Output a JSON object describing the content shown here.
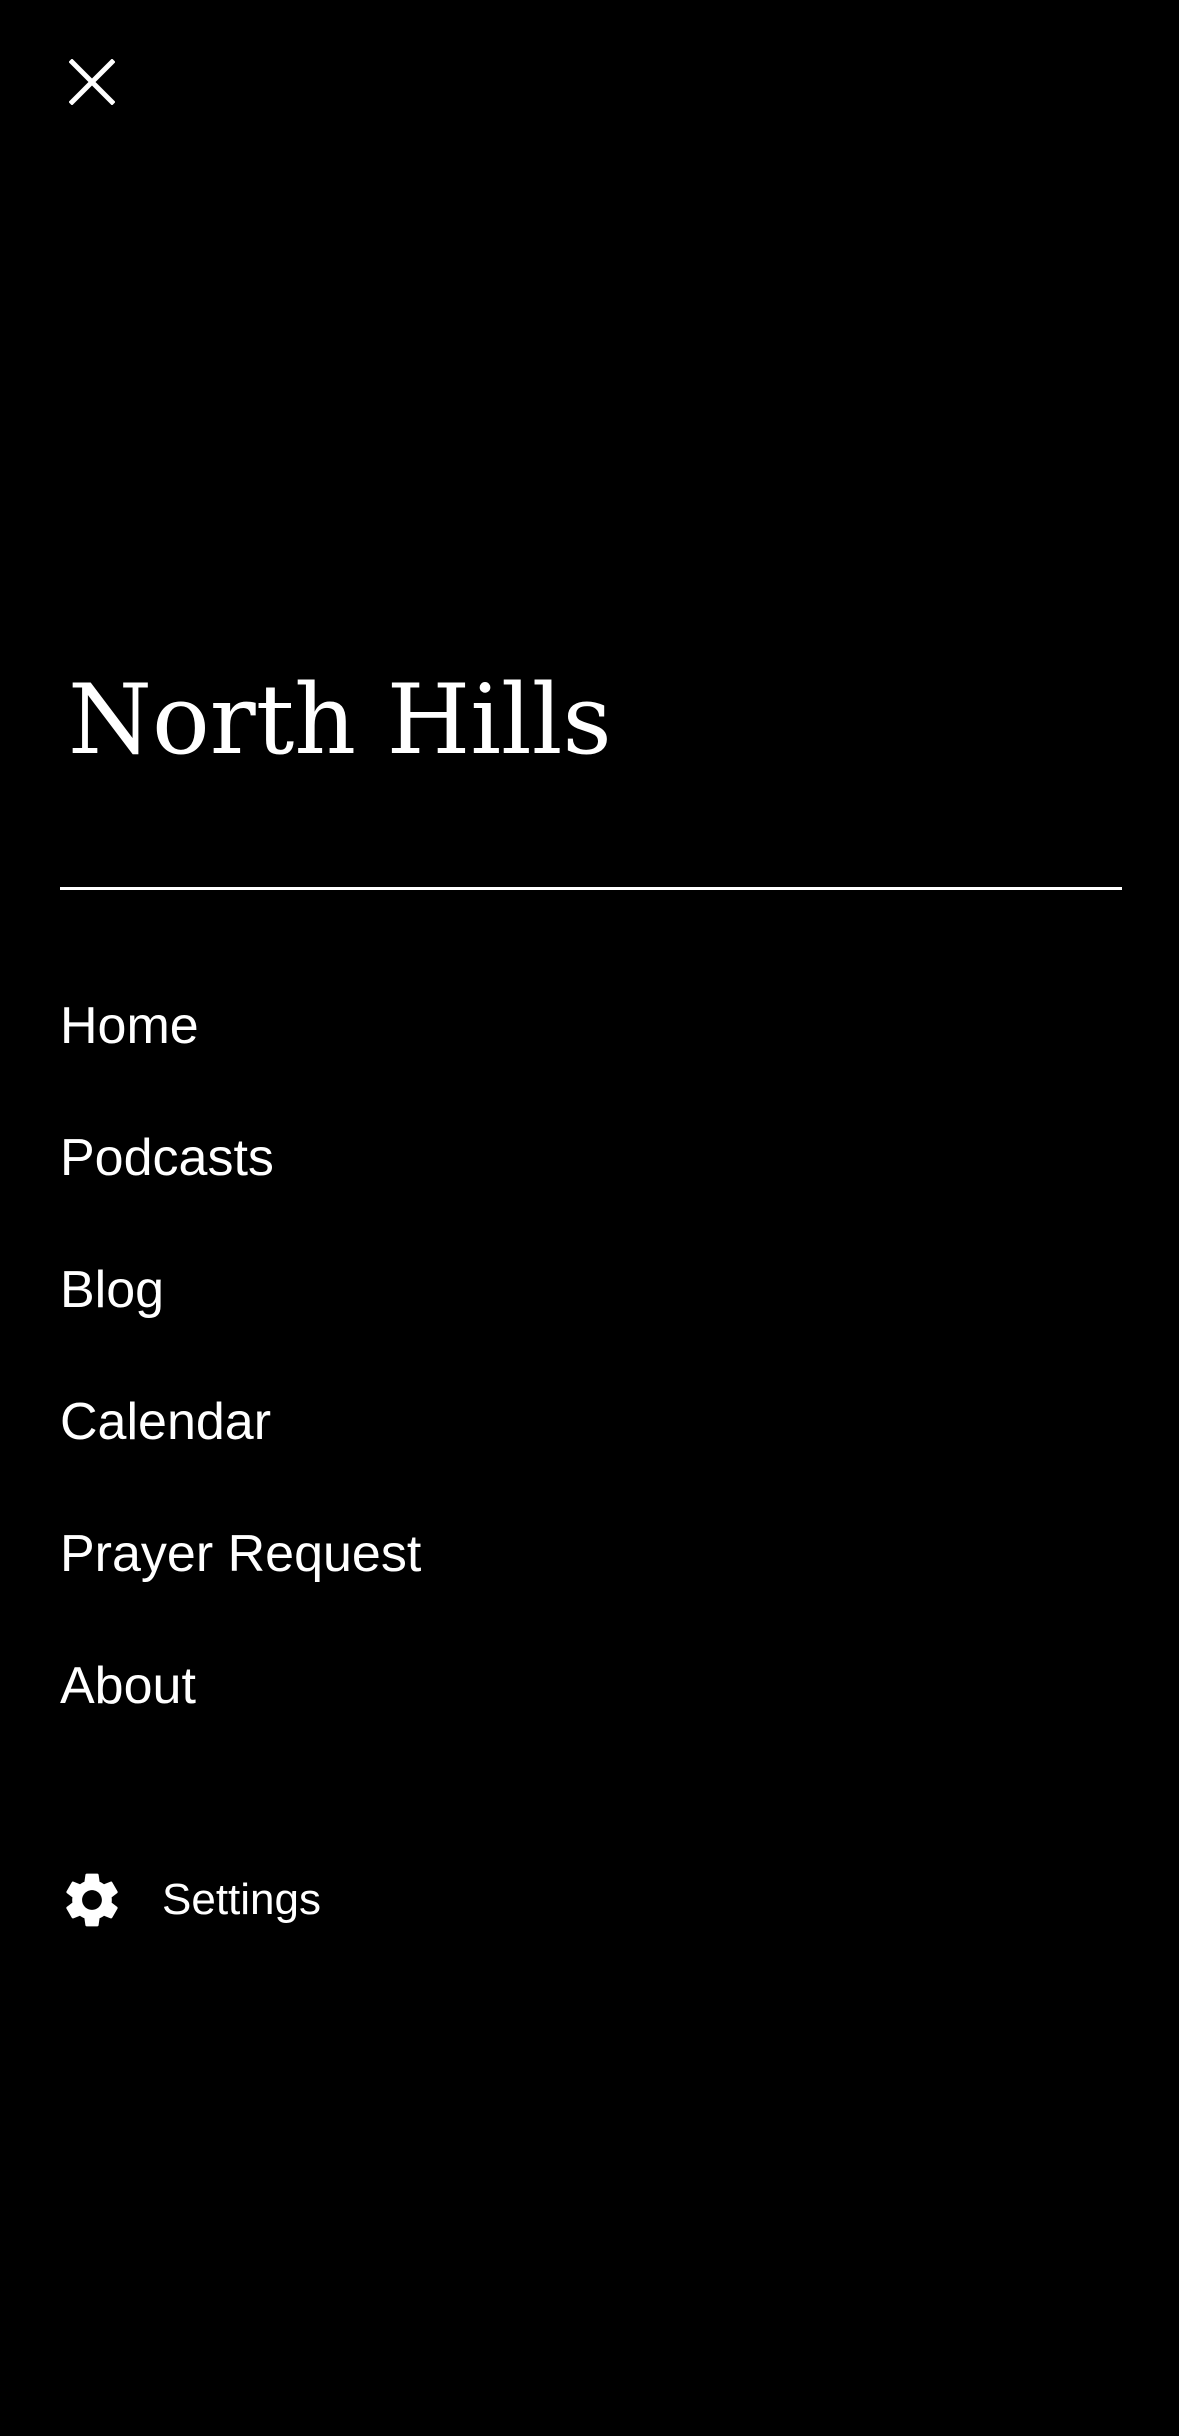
{
  "drawer": {
    "close_icon": "close-icon",
    "title": "North Hills",
    "nav_items": [
      {
        "label": "Home"
      },
      {
        "label": "Podcasts"
      },
      {
        "label": "Blog"
      },
      {
        "label": "Calendar"
      },
      {
        "label": "Prayer Request"
      },
      {
        "label": "About"
      }
    ],
    "settings": {
      "label": "Settings",
      "icon": "gear-icon"
    }
  },
  "colors": {
    "background": "#000000",
    "foreground": "#ffffff"
  }
}
